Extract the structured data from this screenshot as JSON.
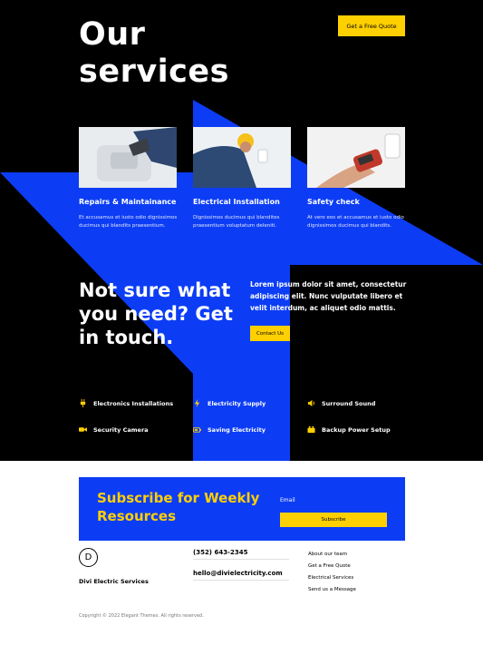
{
  "header": {
    "title": "Our\nservices",
    "quote_button": "Get a Free Quote"
  },
  "services": [
    {
      "title": "Repairs & Maintainance",
      "description": "Et accusamus et iusto odio dignissimos ducimus qui blandits praesentium.",
      "image": "technician-repairing-appliance"
    },
    {
      "title": "Electrical Installation",
      "description": "Dignissimos ducimus qui blandites praesentium voluptatum deleniti.",
      "image": "electrician-installing-outlet"
    },
    {
      "title": "Safety check",
      "description": "At vero eos et accusamus et iusto odio dignissimos ducimus qui blandits.",
      "image": "multimeter-testing-socket"
    }
  ],
  "cta": {
    "heading": "Not sure what you need? Get in touch.",
    "text": "Lorem ipsum dolor sit amet, consectetur adipiscing elit. Nunc vulputate libero et velit interdum, ac aliquet odio mattis.",
    "button": "Contact Us"
  },
  "features": [
    {
      "label": "Electronics Installations",
      "icon": "plug-icon"
    },
    {
      "label": "Electricity Supply",
      "icon": "bolt-icon"
    },
    {
      "label": "Surround Sound",
      "icon": "speaker-icon"
    },
    {
      "label": "Security Camera",
      "icon": "camera-icon"
    },
    {
      "label": "Saving Electricity",
      "icon": "battery-icon"
    },
    {
      "label": "Backup Power Setup",
      "icon": "power-box-icon"
    }
  ],
  "subscribe": {
    "title": "Subscribe for Weekly Resources",
    "email_label": "Email",
    "button": "Subscribe"
  },
  "footer": {
    "logo_letter": "D",
    "company": "Divi Electric Services",
    "phone": "(352) 643-2345",
    "email": "hello@divielectricity.com",
    "links": [
      "About our team",
      "Get a Free Quote",
      "Electrical Services",
      "Send us a Message"
    ],
    "copyright": "Copyright © 2022 Elegant Themes. All rights reserved."
  },
  "colors": {
    "background_dark": "#000000",
    "accent_blue": "#0c3df5",
    "accent_yellow": "#ffd000"
  }
}
